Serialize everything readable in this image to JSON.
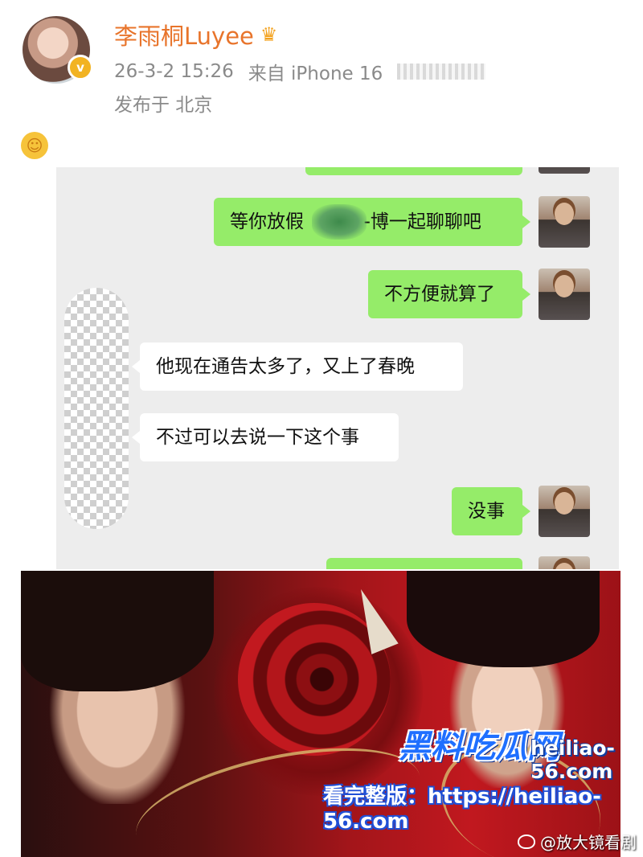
{
  "post": {
    "username": "李雨桐Luyee",
    "timestamp": "26-3-2 15:26",
    "source": "来自 iPhone 16",
    "location": "发布于 北京",
    "verified_mark": "v",
    "crown_icon": "crown-icon",
    "emoji_icon": "yum-emoji-icon"
  },
  "chat": {
    "messages": [
      {
        "side": "me",
        "text": "等你放假"
      },
      {
        "side": "me",
        "text": "-博一起聊聊吧"
      },
      {
        "side": "me",
        "text": "不方便就算了"
      },
      {
        "side": "them",
        "text": "他现在通告太多了，又上了春晚"
      },
      {
        "side": "them",
        "text": "不过可以去说一下这个事"
      },
      {
        "side": "me",
        "text": "没事"
      }
    ]
  },
  "watermarks": {
    "brand": "黑料吃瓜网",
    "url": "heiliao-56.com",
    "full_version": "看完整版：https://heiliao-56.com",
    "source_account": "@放大镜看剧"
  },
  "colors": {
    "username": "#e8742b",
    "my_bubble": "#95ec69",
    "their_bubble": "#ffffff",
    "chat_bg": "#ededed",
    "meta_text": "#8a8a8a"
  }
}
